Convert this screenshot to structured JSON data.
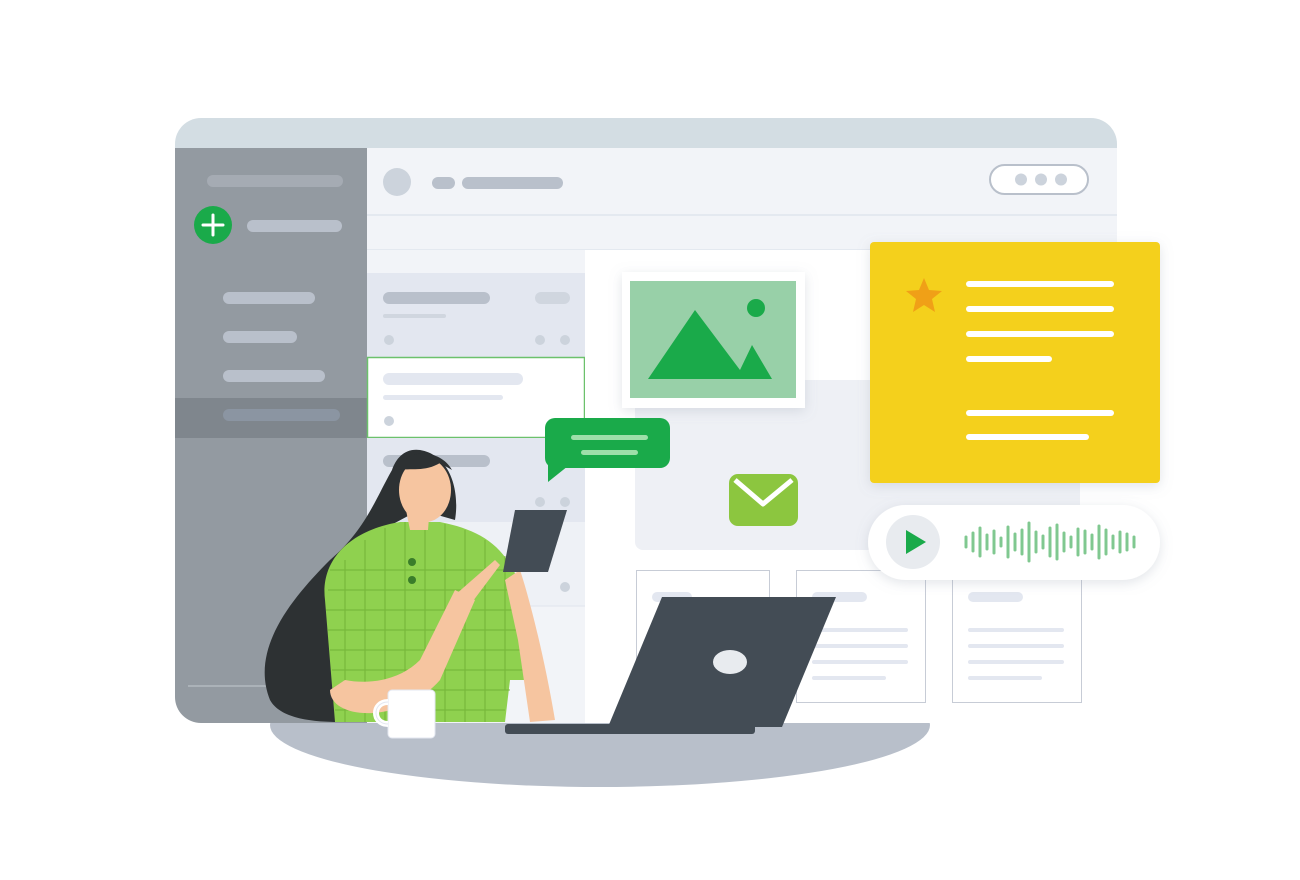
{
  "colors": {
    "accent_green": "#1aaa4a",
    "light_green": "#98d0a8",
    "lime": "#8cc63f",
    "shirt_green": "#8fd14f",
    "note_yellow": "#f4d01c",
    "star_orange": "#f0a017",
    "sidebar_gray": "#939aa1",
    "titlebar": "#d3dde3",
    "placeholder": "#b9c0cb",
    "laptop": "#434c55",
    "hair": "#2d3133",
    "skin": "#f6c5a0"
  },
  "icons": {
    "compose": "plus-icon",
    "image": "image-icon",
    "mail": "envelope-icon",
    "favorite": "star-icon",
    "audio": "play-icon",
    "message": "chat-bubble-icon",
    "menu": "more-dots-icon"
  },
  "audio_player": {
    "state": "paused"
  }
}
